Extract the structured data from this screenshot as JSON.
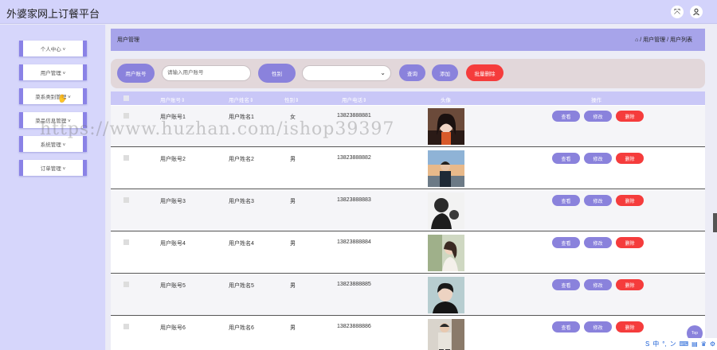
{
  "app": {
    "title": "外婆家网上订餐平台"
  },
  "topbar": {
    "fullscreen_icon": "expand-icon",
    "user_icon": "user-icon"
  },
  "sidebar": {
    "items": [
      {
        "label": "个人中心 ˅"
      },
      {
        "label": "用户管理 ˅"
      },
      {
        "label": "菜系类别管理 ˅"
      },
      {
        "label": "菜品信息管理 ˅"
      },
      {
        "label": "系统管理 ˅"
      },
      {
        "label": "订单管理 ˅"
      }
    ]
  },
  "breadcrumb": {
    "title": "用户管理",
    "path": "⌂ / 用户管理 / 用户列表"
  },
  "search": {
    "account_label": "用户账号",
    "account_placeholder": "请输入用户账号",
    "gender_label": "性别",
    "gender_value": "",
    "query_button": "查询",
    "add_button": "添加",
    "batch_delete_button": "批量删除"
  },
  "table": {
    "headers": [
      "用户账号⇕",
      "用户姓名⇕",
      "性别⇕",
      "用户电话⇕",
      "头像",
      "操作"
    ],
    "actions": {
      "view": "查看",
      "edit": "修改",
      "delete": "删除"
    },
    "rows": [
      {
        "account": "用户账号1",
        "name": "用户姓名1",
        "gender": "女",
        "phone": "13823888881"
      },
      {
        "account": "用户账号2",
        "name": "用户姓名2",
        "gender": "男",
        "phone": "13823888882"
      },
      {
        "account": "用户账号3",
        "name": "用户姓名3",
        "gender": "男",
        "phone": "13823888883"
      },
      {
        "account": "用户账号4",
        "name": "用户姓名4",
        "gender": "男",
        "phone": "13823888884"
      },
      {
        "account": "用户账号5",
        "name": "用户姓名5",
        "gender": "男",
        "phone": "13823888885"
      },
      {
        "account": "用户账号6",
        "name": "用户姓名6",
        "gender": "男",
        "phone": "13823888886"
      }
    ]
  },
  "watermark": "https://www.huzhan.com/ishop39397",
  "top_button": "Top",
  "ime_bar": [
    "S",
    "中",
    "°,",
    "ン",
    "⌨",
    "▤",
    "♛",
    "⚙"
  ],
  "colors": {
    "accent": "#8a82dc",
    "danger": "#f53c3c",
    "header": "#a7a4ea"
  }
}
